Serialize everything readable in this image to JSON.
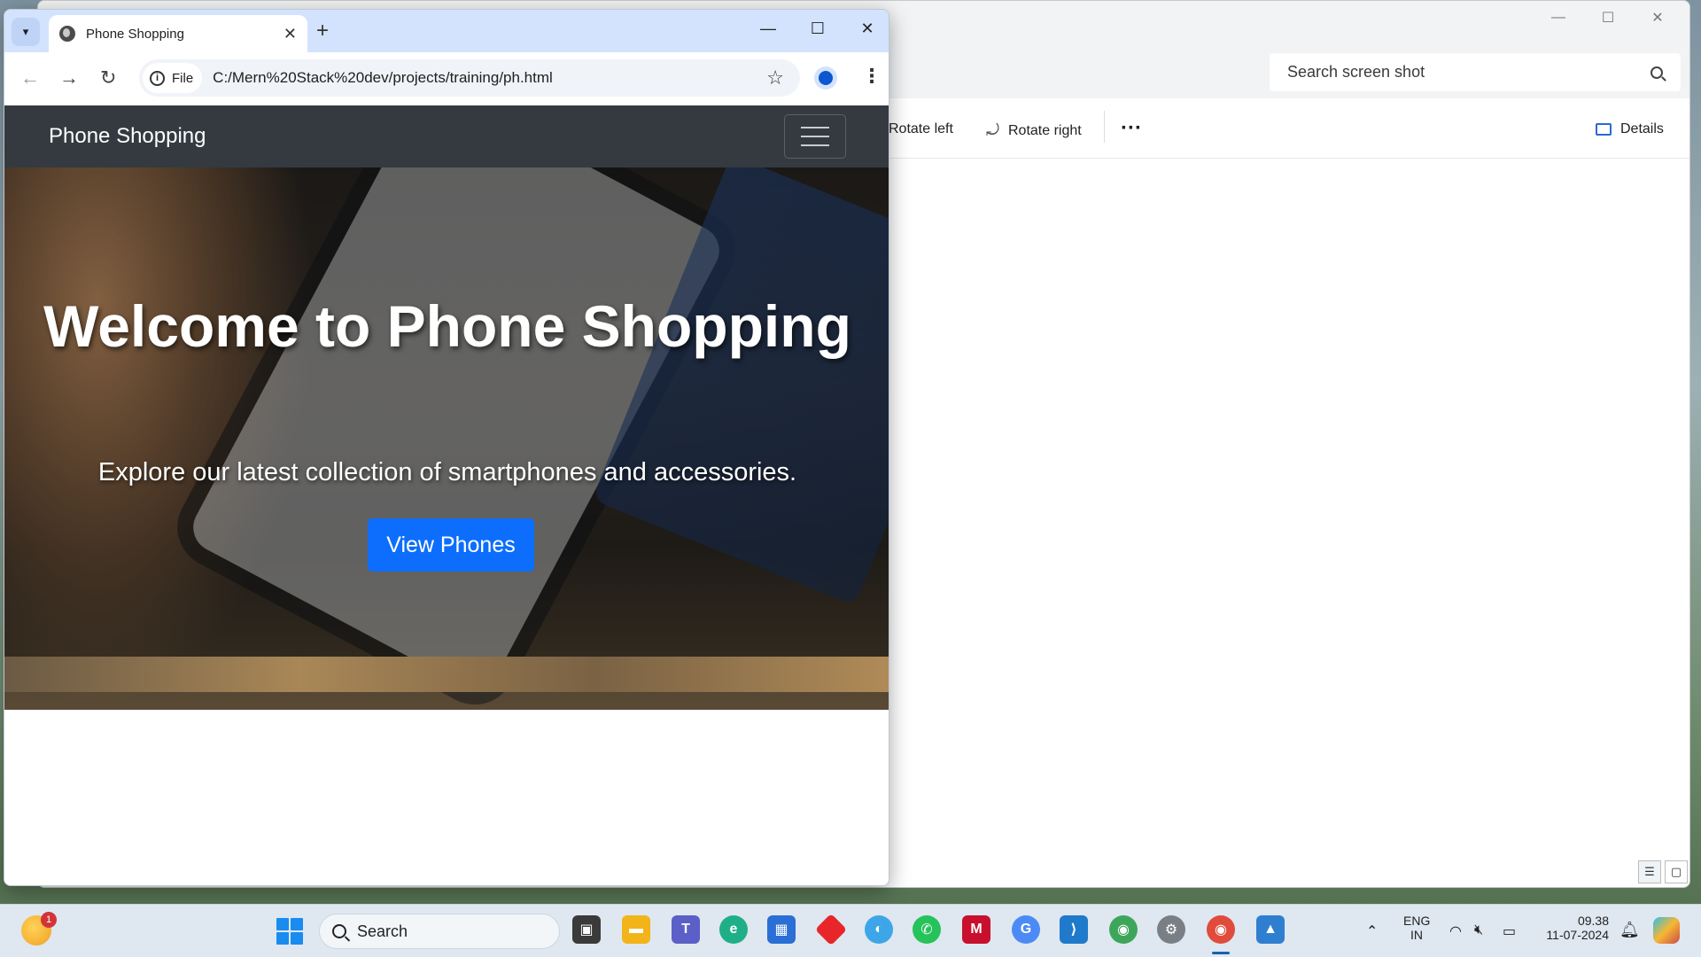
{
  "photos": {
    "search_placeholder": "Search screen shot",
    "toolbar": {
      "rotate_left": "Rotate left",
      "rotate_right": "Rotate right",
      "more": "···",
      "details": "Details"
    }
  },
  "chrome": {
    "tab_title": "Phone Shopping",
    "scheme_chip": "File",
    "url": "C:/Mern%20Stack%20dev/projects/training/ph.html"
  },
  "site": {
    "brand": "Phone Shopping",
    "hero_title": "Welcome to Phone Shopping",
    "hero_subtitle": "Explore our latest collection of smartphones and accessories.",
    "cta": "View Phones"
  },
  "taskbar": {
    "search_label": "Search",
    "weather_badge": "1",
    "lang": "ENG",
    "region": "IN",
    "time": "09.38",
    "date": "11-07-2024"
  },
  "colors": {
    "navbar": "#343a40",
    "cta": "#0d6efd",
    "tabstrip": "#d3e3fd"
  }
}
